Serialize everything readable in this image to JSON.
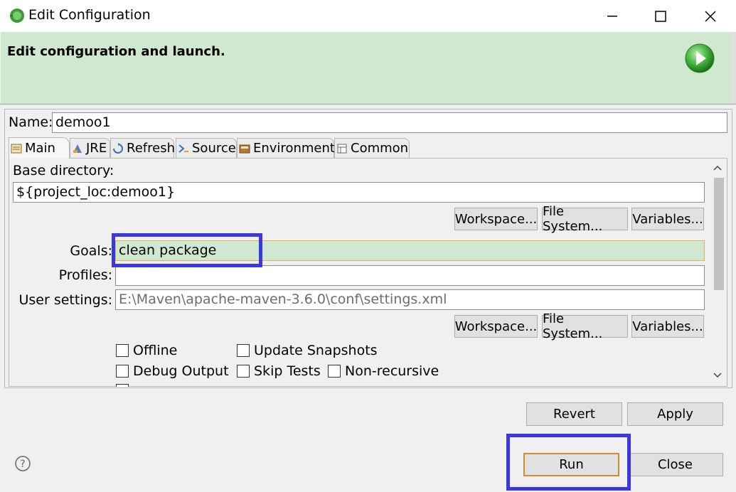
{
  "window": {
    "title": "Edit Configuration"
  },
  "banner": {
    "title": "Edit configuration and launch."
  },
  "name": {
    "label": "Name:",
    "value": "demoo1"
  },
  "tabs": [
    {
      "label": "Main",
      "icon": "main-tab-icon"
    },
    {
      "label": "JRE",
      "icon": "jre-icon"
    },
    {
      "label": "Refresh",
      "icon": "refresh-icon"
    },
    {
      "label": "Source",
      "icon": "source-icon"
    },
    {
      "label": "Environment",
      "icon": "environment-icon"
    },
    {
      "label": "Common",
      "icon": "common-icon"
    }
  ],
  "main": {
    "base_directory_label": "Base directory:",
    "base_directory_value": "${project_loc:demoo1}",
    "workspace_label": "Workspace...",
    "file_system_label": "File System...",
    "variables_label": "Variables...",
    "goals_label": "Goals:",
    "goals_value": "clean package",
    "profiles_label": "Profiles:",
    "profiles_value": "",
    "user_settings_label": "User settings:",
    "user_settings_value": "E:\\Maven\\apache-maven-3.6.0\\conf\\settings.xml",
    "checkboxes": {
      "offline": "Offline",
      "update_snapshots": "Update Snapshots",
      "debug_output": "Debug Output",
      "skip_tests": "Skip Tests",
      "non_recursive": "Non-recursive"
    }
  },
  "buttons": {
    "revert": "Revert",
    "apply": "Apply",
    "run": "Run",
    "close": "Close"
  },
  "colors": {
    "banner": "#cfe8cf",
    "highlight": "#3a36e0",
    "run_border": "#d48a2e"
  }
}
